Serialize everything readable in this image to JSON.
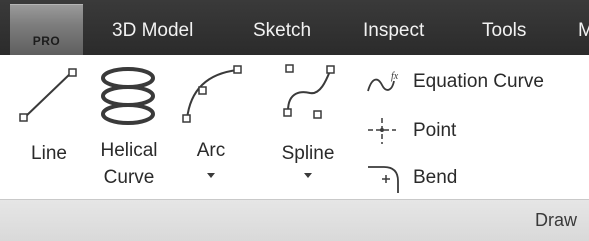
{
  "tabs": {
    "app_button": "PRO",
    "items": [
      {
        "label": "3D Model"
      },
      {
        "label": "Sketch"
      },
      {
        "label": "Inspect"
      },
      {
        "label": "Tools"
      },
      {
        "label": "M"
      }
    ]
  },
  "draw_panel": {
    "title": "Draw",
    "large_tools": [
      {
        "label": "Line",
        "icon": "line-icon"
      },
      {
        "label_line1": "Helical",
        "label_line2": "Curve",
        "icon": "helical-curve-icon"
      },
      {
        "label": "Arc",
        "icon": "arc-icon"
      },
      {
        "label": "Spline",
        "icon": "spline-icon"
      }
    ],
    "small_tools": [
      {
        "label": "Equation Curve",
        "icon": "equation-curve-icon"
      },
      {
        "label": "Point",
        "icon": "point-icon"
      },
      {
        "label": "Bend",
        "icon": "bend-icon"
      }
    ]
  }
}
